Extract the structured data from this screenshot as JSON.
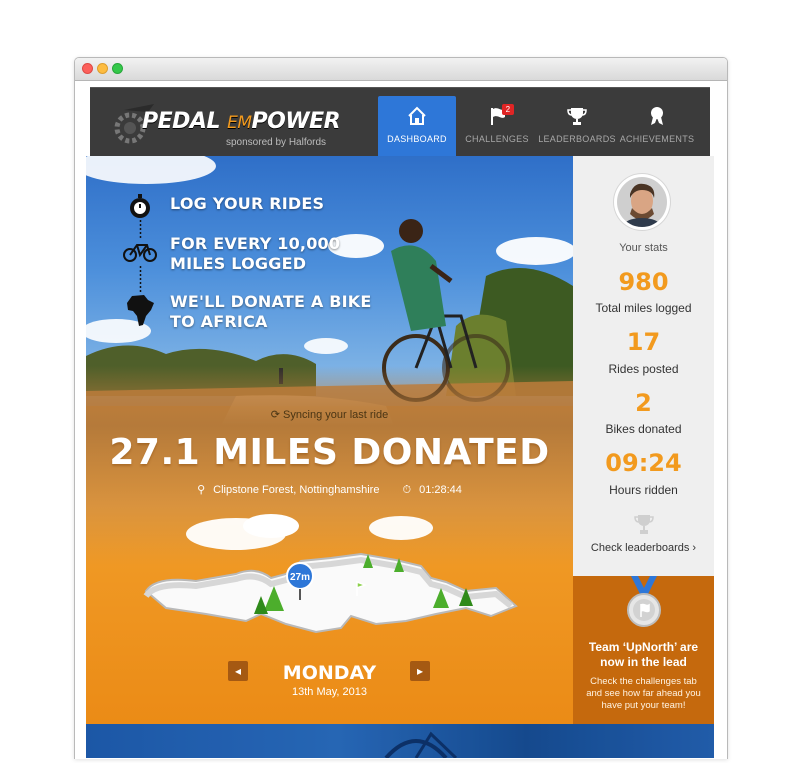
{
  "nav": {
    "logo_pre": "PEDAL ",
    "logo_em": "EM",
    "logo_post": "POWER",
    "logo_sub": "sponsored by Halfords",
    "tabs": [
      {
        "label": "DASHBOARD",
        "icon": "home-icon",
        "active": true
      },
      {
        "label": "CHALLENGES",
        "icon": "flag-icon",
        "badge": "2"
      },
      {
        "label": "LEADERBOARDS",
        "icon": "trophy-icon"
      },
      {
        "label": "ACHIEVEMENTS",
        "icon": "rosette-icon"
      }
    ]
  },
  "steps": [
    {
      "text": "LOG YOUR RIDES",
      "icon": "stopwatch-icon"
    },
    {
      "text": "FOR EVERY 10,000\nMILES LOGGED",
      "icon": "bicycle-icon"
    },
    {
      "text": "WE'LL DONATE A BIKE\nTO AFRICA",
      "icon": "africa-icon"
    }
  ],
  "ride": {
    "sync_text": "Syncing your last ride",
    "miles_donated": "27.1 MILES DONATED",
    "location": "Clipstone Forest, Nottinghamshire",
    "duration": "01:28:44",
    "marker": "27m",
    "day": "MONDAY",
    "date": "13th May, 2013"
  },
  "stats": {
    "heading": "Your stats",
    "items": [
      {
        "value": "980",
        "label": "Total miles logged"
      },
      {
        "value": "17",
        "label": "Rides posted"
      },
      {
        "value": "2",
        "label": "Bikes donated"
      },
      {
        "value": "09:24",
        "label": "Hours ridden"
      }
    ],
    "check_link": "Check leaderboards ›"
  },
  "team": {
    "title": "Team ‘UpNorth’ are now in the lead",
    "text": "Check the challenges tab and see how far ahead you have put your team!"
  },
  "colors": {
    "accent_orange": "#f29a1e",
    "nav_active": "#2e77d8",
    "team_panel": "#c5690d"
  }
}
